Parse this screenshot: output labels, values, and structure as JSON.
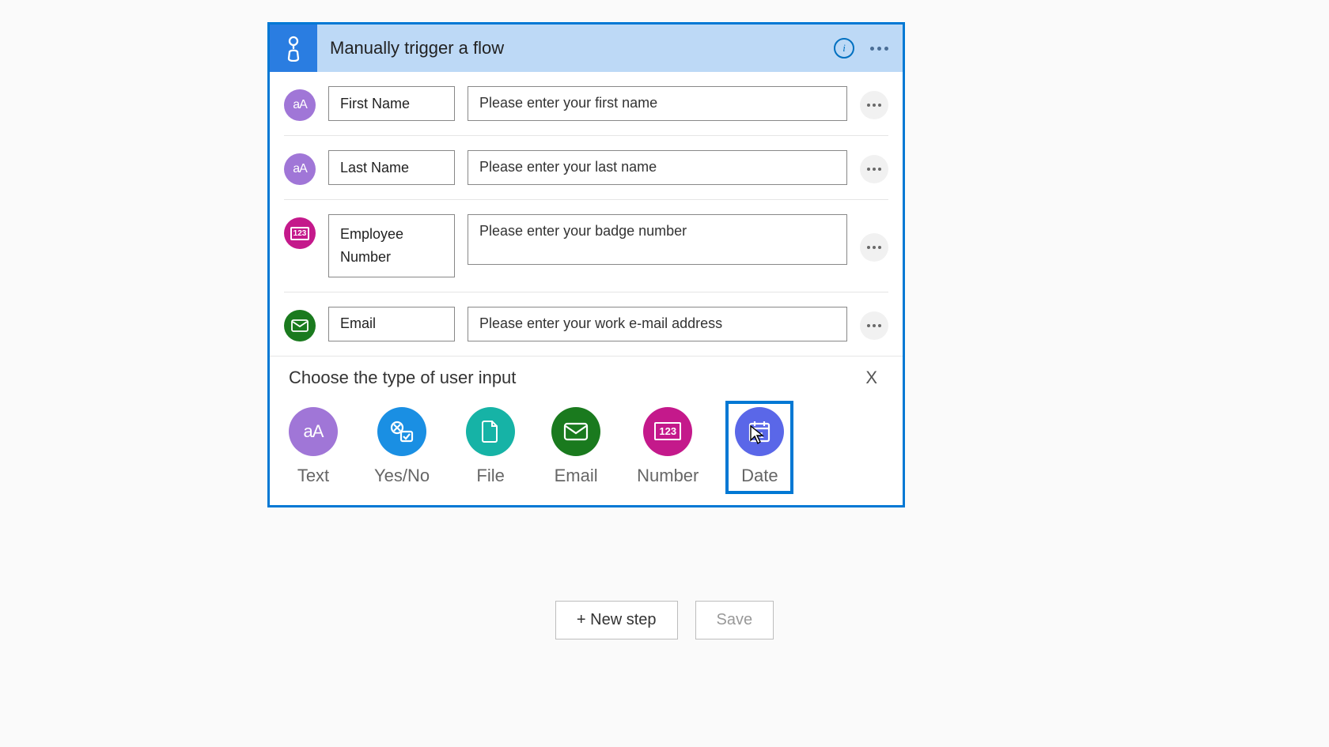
{
  "header": {
    "title": "Manually trigger a flow",
    "icon": "manual-trigger-icon"
  },
  "inputs": [
    {
      "type": "text",
      "name": "First Name",
      "prompt": "Please enter your first name"
    },
    {
      "type": "text",
      "name": "Last Name",
      "prompt": "Please enter your last name"
    },
    {
      "type": "number",
      "name": "Employee Number",
      "prompt": "Please enter your badge number"
    },
    {
      "type": "email",
      "name": "Email",
      "prompt": "Please enter your work e-mail address"
    }
  ],
  "chooser": {
    "title": "Choose the type of user input",
    "close": "X",
    "options": [
      {
        "id": "text",
        "label": "Text"
      },
      {
        "id": "yesno",
        "label": "Yes/No"
      },
      {
        "id": "file",
        "label": "File"
      },
      {
        "id": "email",
        "label": "Email"
      },
      {
        "id": "number",
        "label": "Number"
      },
      {
        "id": "date",
        "label": "Date"
      }
    ],
    "selected": "date"
  },
  "buttons": {
    "new_step": "+ New step",
    "save": "Save"
  }
}
